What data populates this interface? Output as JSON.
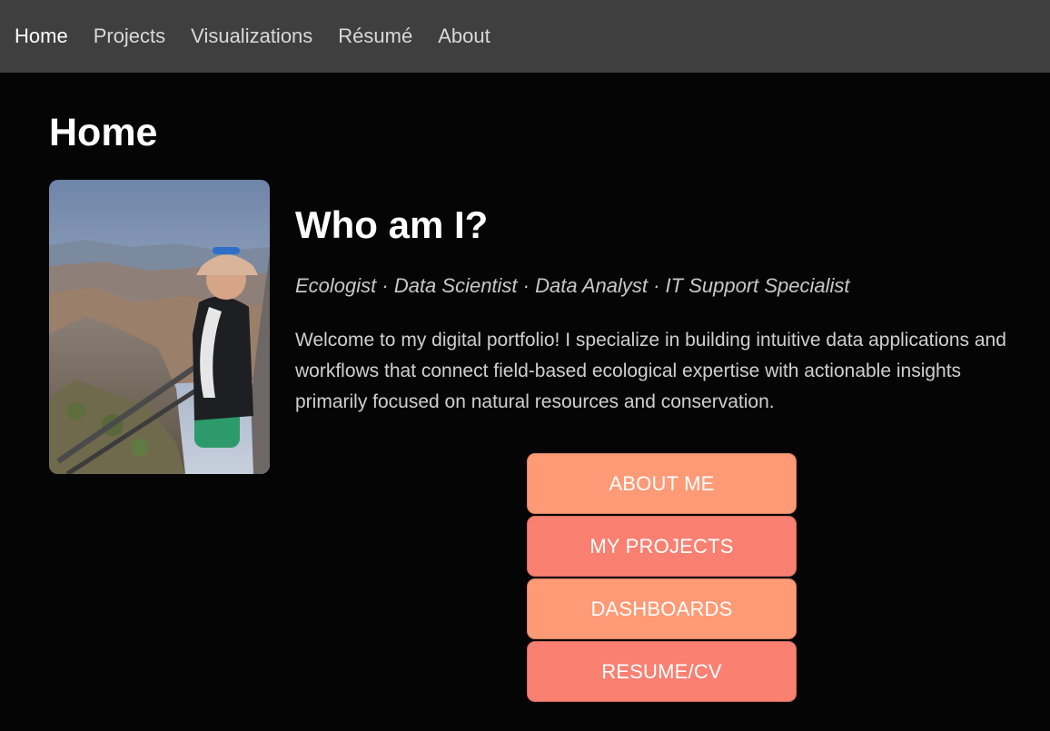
{
  "nav": {
    "items": [
      {
        "label": "Home",
        "active": true
      },
      {
        "label": "Projects",
        "active": false
      },
      {
        "label": "Visualizations",
        "active": false
      },
      {
        "label": "Résumé",
        "active": false
      },
      {
        "label": "About",
        "active": false
      }
    ]
  },
  "page": {
    "title": "Home"
  },
  "intro": {
    "photo_icon": "profile-photo",
    "heading": "Who am I?",
    "roles": "Ecologist · Data Scientist · Data Analyst · IT Support Specialist",
    "body": "Welcome to my digital portfolio! I specialize in building intuitive data applications and workflows that connect field-based ecological expertise with actionable insights primarily focused on natural resources and conservation."
  },
  "buttons": [
    {
      "label": "ABOUT ME",
      "color": "#ff9a76"
    },
    {
      "label": "MY PROJECTS",
      "color": "#fa8072"
    },
    {
      "label": "DASHBOARDS",
      "color": "#ff9a76"
    },
    {
      "label": "RESUME/CV",
      "color": "#fa8072"
    }
  ],
  "colors": {
    "navbar_bg": "#3f3f3f",
    "page_bg": "#050505"
  }
}
